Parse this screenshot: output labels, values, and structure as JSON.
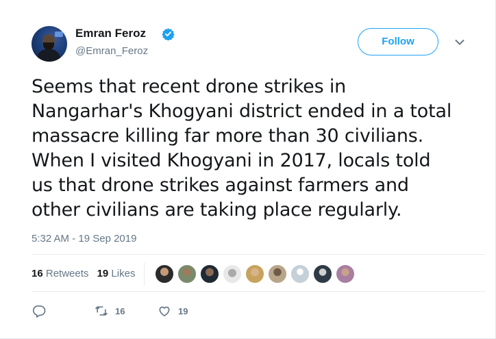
{
  "author": {
    "name": "Emran Feroz",
    "handle": "@Emran_Feroz",
    "verified": true,
    "avatar_icon": "user-avatar"
  },
  "follow_button": {
    "label": "Follow"
  },
  "menu_icon": "chevron-down-icon",
  "tweet": {
    "lines": [
      "Seems that recent drone strikes in",
      "Nangarhar's Khogyani district ended in a total",
      "massacre killing far more than 30 civilians.",
      "When I visited Khogyani in 2017, locals told",
      "us that drone strikes against farmers and",
      "other civilians are taking place regularly."
    ],
    "timestamp": "5:32 AM - 19 Sep 2019"
  },
  "stats": {
    "retweets": {
      "count": "16",
      "label": "Retweets"
    },
    "likes": {
      "count": "19",
      "label": "Likes"
    }
  },
  "liker_avatar_count": 9,
  "actions": {
    "reply": {
      "icon": "reply-icon"
    },
    "retweet": {
      "icon": "retweet-icon",
      "count": "16"
    },
    "like": {
      "icon": "heart-icon",
      "count": "19"
    }
  },
  "colors": {
    "accent": "#1da1f2",
    "secondary_text": "#657786",
    "primary_text": "#14171a",
    "divider": "#e6ecf0"
  }
}
